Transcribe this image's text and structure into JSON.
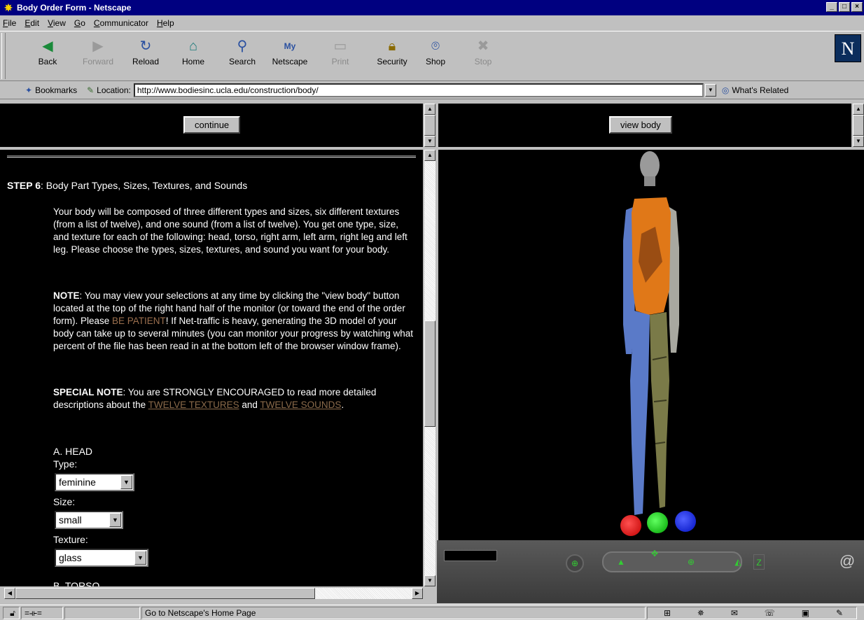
{
  "window": {
    "title": "Body Order Form - Netscape",
    "buttons": [
      "_",
      "□",
      "×"
    ]
  },
  "menu": [
    "File",
    "Edit",
    "View",
    "Go",
    "Communicator",
    "Help"
  ],
  "toolbar": {
    "back": "Back",
    "forward": "Forward",
    "reload": "Reload",
    "home": "Home",
    "search": "Search",
    "netscape": "Netscape",
    "print": "Print",
    "security": "Security",
    "shop": "Shop",
    "stop": "Stop"
  },
  "location": {
    "bookmarks": "Bookmarks",
    "label": "Location:",
    "url": "http://www.bodiesinc.ucla.edu/construction/body/",
    "related": "What's Related"
  },
  "left_top": {
    "continue_label": "continue"
  },
  "right_top": {
    "view_body_label": "view body"
  },
  "form": {
    "step_bold": "STEP 6",
    "step_text": ": Body Part Types, Sizes, Textures, and Sounds",
    "intro": "Your body will be composed of three different types and sizes, six different textures (from a list of twelve), and one sound (from a list of twelve). You get one type, size, and texture for each of the following: head, torso, right arm, left arm, right leg and left leg. Please choose the types, sizes, textures, and sound you want for your body.",
    "note_bold": "NOTE",
    "note_text_1": ": You may view your selections at any time by clicking the \"view body\" button located at the top of the right hand half of the monitor (or toward the end of the order form). Please ",
    "note_patient": "BE PATIENT",
    "note_text_2": "! If Net-traffic is heavy, generating the 3D model of your body can take up to several minutes (you can monitor your progress by watching what percent of the file has been read in at the bottom left of the browser window frame).",
    "special_bold": "SPECIAL NOTE",
    "special_text": ": You are STRONGLY ENCOURAGED to read more detailed descriptions about the ",
    "link_textures": "TWELVE TEXTURES",
    "special_and": " and ",
    "link_sounds": "TWELVE SOUNDS",
    "special_end": ".",
    "head_heading": "A. HEAD",
    "type_label": "Type:",
    "type_value": "feminine",
    "size_label": "Size:",
    "size_value": "small",
    "texture_label": "Texture:",
    "texture_value": "glass",
    "torso_heading": "B. TORSO"
  },
  "status": {
    "message": "Go to Netscape's Home Page"
  },
  "colors": {
    "titlebar": "#000080",
    "chrome": "#c0c0c0",
    "frame_bg": "#000000",
    "link": "#8a6a4a",
    "ball_red": "#e00000",
    "ball_green": "#00d000",
    "ball_blue": "#0020e0"
  }
}
